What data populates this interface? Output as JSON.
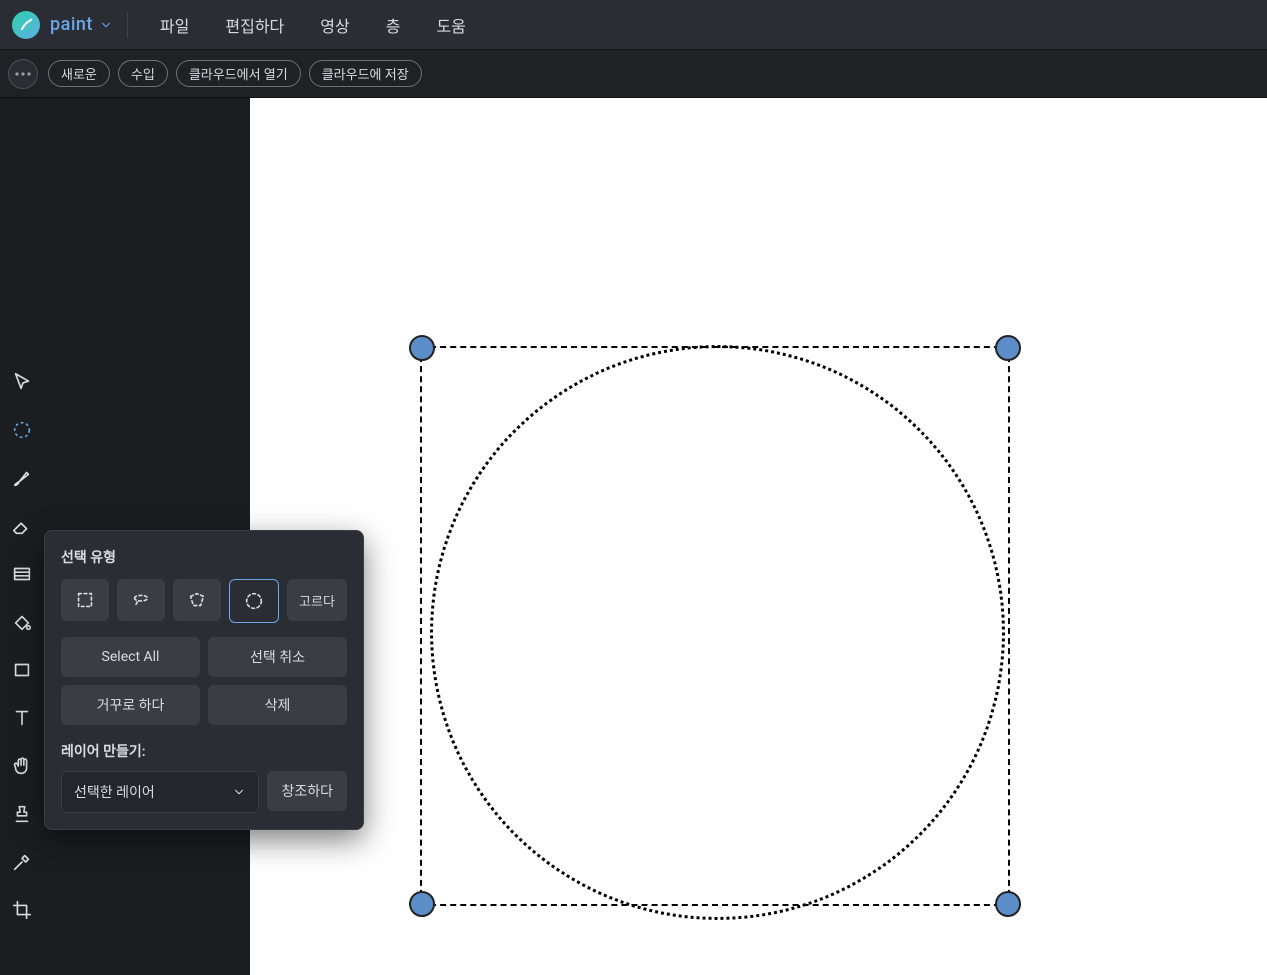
{
  "app": {
    "name": "paint"
  },
  "menu": {
    "file": "파일",
    "edit": "편집하다",
    "video": "영상",
    "layer": "층",
    "help": "도움"
  },
  "secbar": {
    "new": "새로운",
    "open": "수입",
    "open_cloud": "클라우드에서 열기",
    "save_cloud": "클라우드에 저장"
  },
  "popover": {
    "title": "선택 유형",
    "crop": "고르다",
    "select_all": "Select All",
    "deselect": "선택 취소",
    "invert": "거꾸로 하다",
    "delete": "삭제",
    "make_layer_title": "레이어 만들기:",
    "selected_layer": "선택한 레이어",
    "create": "창조하다"
  }
}
